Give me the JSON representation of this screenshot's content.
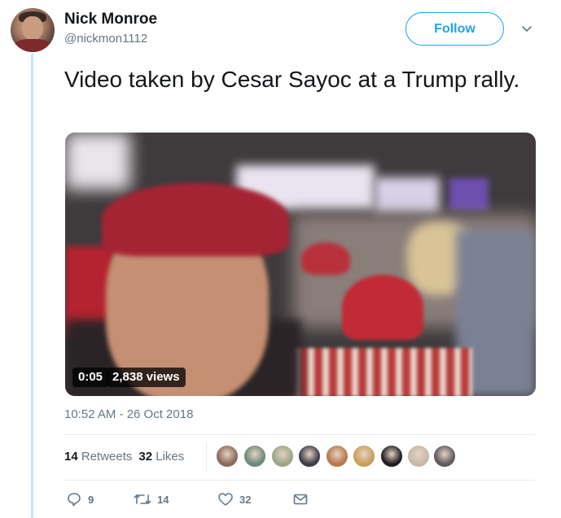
{
  "author": {
    "name": "Nick Monroe",
    "handle": "@nickmon1112"
  },
  "follow_label": "Follow",
  "tweet": {
    "text": "Video taken by Cesar Sayoc at a Trump rally."
  },
  "media": {
    "elapsed": "0:05",
    "views": "2,838 views"
  },
  "timestamp": "10:52 AM - 26 Oct 2018",
  "stats": {
    "retweets_count": "14",
    "retweets_label": "Retweets",
    "likes_count": "32",
    "likes_label": "Likes"
  },
  "likers": [
    {
      "icon": "avatar-1",
      "color": "#8a6b5c"
    },
    {
      "icon": "avatar-2",
      "color": "#6e8a7a"
    },
    {
      "icon": "avatar-3",
      "color": "#9aa58a"
    },
    {
      "icon": "avatar-4",
      "color": "#3b3d4a"
    },
    {
      "icon": "avatar-5",
      "color": "#b8784e"
    },
    {
      "icon": "avatar-6",
      "color": "#c9a05a"
    },
    {
      "icon": "avatar-7",
      "color": "#1f1f22"
    },
    {
      "icon": "avatar-8",
      "color": "#c7b9a9"
    },
    {
      "icon": "avatar-9",
      "color": "#5d5a5e"
    }
  ],
  "actions": {
    "reply_count": "9",
    "retweet_count": "14",
    "like_count": "32"
  },
  "colors": {
    "accent": "#1da1f2",
    "secondary_text": "#657786",
    "thread_line": "#c4e3f7"
  }
}
